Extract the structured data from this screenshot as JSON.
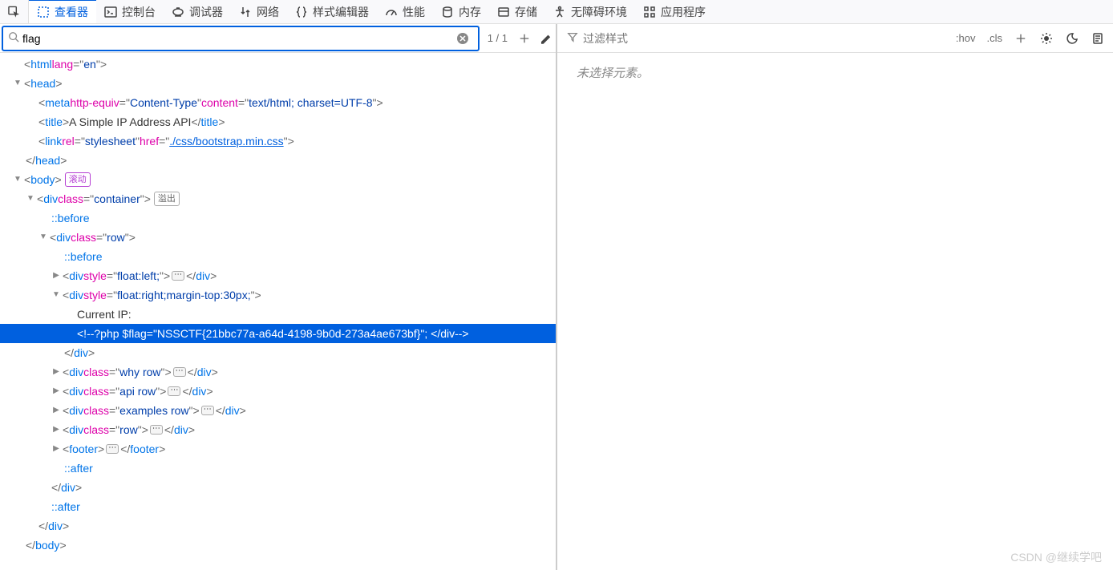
{
  "toolbar": {
    "tabs": {
      "inspector": "查看器",
      "console": "控制台",
      "debugger": "调试器",
      "network": "网络",
      "style_editor": "样式编辑器",
      "performance": "性能",
      "memory": "内存",
      "storage": "存储",
      "accessibility": "无障碍环境",
      "application": "应用程序"
    }
  },
  "search": {
    "value": "flag",
    "result": "1 / 1"
  },
  "styles": {
    "filter_placeholder": "过滤样式",
    "hov": ":hov",
    "cls": ".cls",
    "no_selection": "未选择元素。"
  },
  "dom": {
    "html_open": "<html lang=\"en\">",
    "head_open": "<head>",
    "meta": {
      "attr1": "http-equiv",
      "val1": "Content-Type",
      "attr2": "content",
      "val2": "text/html; charset=UTF-8"
    },
    "title_text": "A Simple IP Address API",
    "link": {
      "rel": "stylesheet",
      "href": "./css/bootstrap.min.css"
    },
    "head_close": "</head>",
    "body_open": "<body>",
    "body_badge": "滚动",
    "container_class": "container",
    "container_badge": "溢出",
    "pseudo_before": "::before",
    "pseudo_after": "::after",
    "row_class": "row",
    "float_left_style": "float:left;",
    "float_right_style": "float:right;margin-top:30px;",
    "current_ip": "Current IP:",
    "flag_comment": "<!--?php $flag=\"NSSCTF{21bbc77a-a64d-4198-9b0d-273a4ae673bf}\"; </div-->",
    "div_close": "</div>",
    "why_row": "why row",
    "api_row": "api row",
    "examples_row": "examples row",
    "body_close": "</body>"
  },
  "watermark": "CSDN @继续学吧"
}
